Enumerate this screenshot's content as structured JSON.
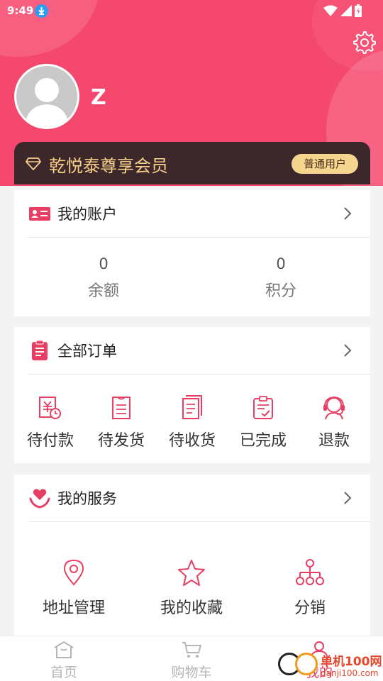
{
  "status_bar": {
    "time": "9:49"
  },
  "profile": {
    "username": "Z"
  },
  "member": {
    "title": "乾悦泰尊享会员",
    "level_tag": "普通用户"
  },
  "account": {
    "title": "我的账户",
    "stats": [
      {
        "value": "0",
        "label": "余额"
      },
      {
        "value": "0",
        "label": "积分"
      }
    ]
  },
  "orders": {
    "title": "全部订单",
    "items": [
      {
        "label": "待付款",
        "icon": "pending-payment-icon"
      },
      {
        "label": "待发货",
        "icon": "pending-shipment-icon"
      },
      {
        "label": "待收货",
        "icon": "pending-receipt-icon"
      },
      {
        "label": "已完成",
        "icon": "completed-icon"
      },
      {
        "label": "退款",
        "icon": "refund-icon"
      }
    ]
  },
  "services": {
    "title": "我的服务",
    "items": [
      {
        "label": "地址管理",
        "icon": "location-icon"
      },
      {
        "label": "我的收藏",
        "icon": "star-icon"
      },
      {
        "label": "分销",
        "icon": "distribution-icon"
      }
    ]
  },
  "tabbar": {
    "items": [
      {
        "label": "首页",
        "icon": "home-icon"
      },
      {
        "label": "购物车",
        "icon": "cart-icon"
      },
      {
        "label": "我的",
        "icon": "user-icon"
      }
    ]
  },
  "watermark": {
    "line1": "单机100网",
    "line2": "danji100.com"
  },
  "colors": {
    "brand": "#f5486e",
    "accent_icon": "#e83e64",
    "member_bg": "#3c272b",
    "member_gold": "#f6cf8b"
  }
}
